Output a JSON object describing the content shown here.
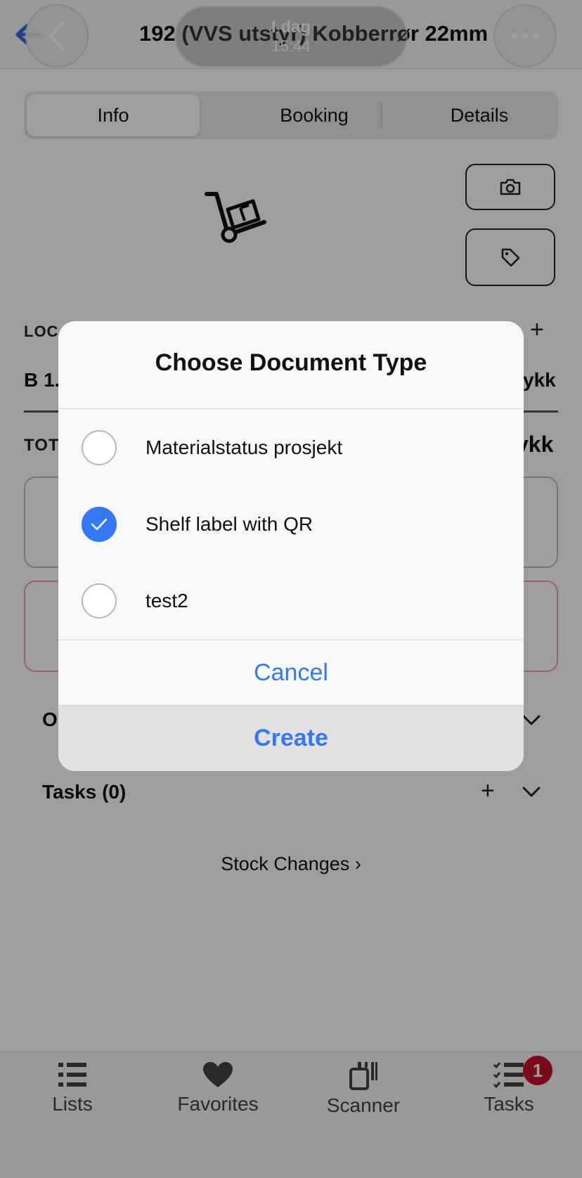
{
  "header": {
    "title": "192 (VVS utstyr) Kobberrør 22mm",
    "time_day": "I dag",
    "time_clock": "15:44"
  },
  "tabs": [
    {
      "label": "Info",
      "active": true
    },
    {
      "label": "Booking",
      "active": false
    },
    {
      "label": "Details",
      "active": false
    }
  ],
  "sections": {
    "location_label": "LOC",
    "location_value": "B 1.",
    "location_unit": "ykk",
    "total_label": "TOT",
    "total_unit": "ykk",
    "orders_label": "O",
    "tasks_label": "Tasks (0)"
  },
  "stock_changes": "Stock Changes",
  "modal": {
    "title": "Choose Document Type",
    "options": [
      {
        "label": "Materialstatus prosjekt",
        "checked": false
      },
      {
        "label": "Shelf label with QR",
        "checked": true
      },
      {
        "label": "test2",
        "checked": false
      }
    ],
    "cancel": "Cancel",
    "create": "Create"
  },
  "tabbar": {
    "items": [
      {
        "label": "Lists",
        "icon": "list-icon"
      },
      {
        "label": "Favorites",
        "icon": "heart-icon"
      },
      {
        "label": "Scanner",
        "icon": "scanner-icon"
      },
      {
        "label": "Tasks",
        "icon": "tasks-icon"
      }
    ],
    "tasks_badge": "1"
  },
  "colors": {
    "accent": "#3478f6",
    "badge": "#c8102e"
  }
}
